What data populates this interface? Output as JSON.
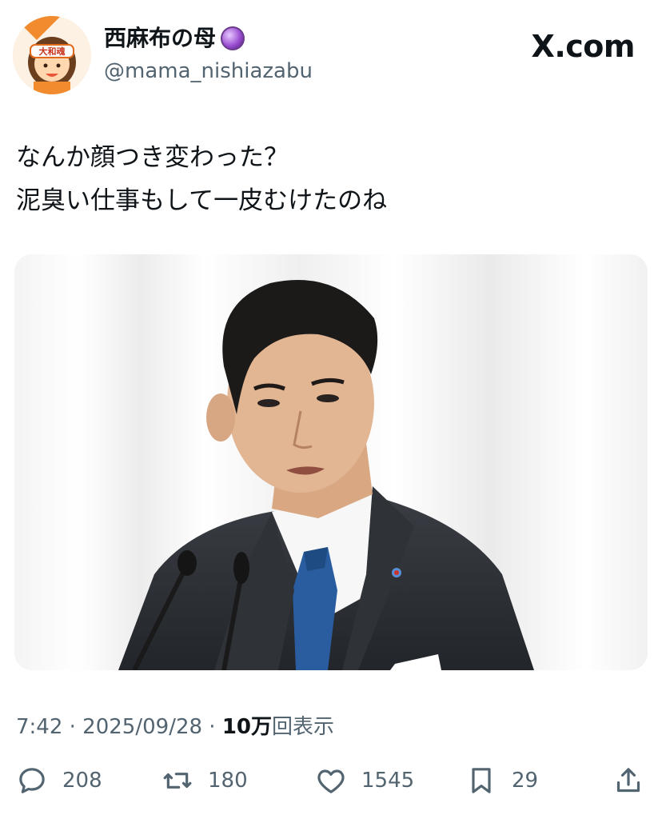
{
  "author": {
    "display_name": "西麻布の母",
    "handle": "@mama_nishiazabu",
    "avatar_headband_text": "大和魂",
    "badge_icon": "crystal-ball-emoji"
  },
  "site_label": "X.com",
  "tweet": {
    "lines": [
      "なんか顔つき変わった？",
      "泥臭い仕事もして一皮むけたのね"
    ]
  },
  "meta": {
    "time_date": "7:42 · 2025/09/28 · ",
    "views_count": "10万",
    "views_suffix": "回表示"
  },
  "actions": {
    "replies": "208",
    "reposts": "180",
    "likes": "1545",
    "bookmarks": "29"
  },
  "icons": {
    "reply": "reply-icon",
    "repost": "repost-icon",
    "like": "heart-icon",
    "bookmark": "bookmark-icon",
    "share": "share-icon"
  },
  "colors": {
    "text_primary": "#0f1419",
    "text_secondary": "#536471",
    "tie_blue": "#2a5d9f",
    "suit": "#2b2e33"
  }
}
